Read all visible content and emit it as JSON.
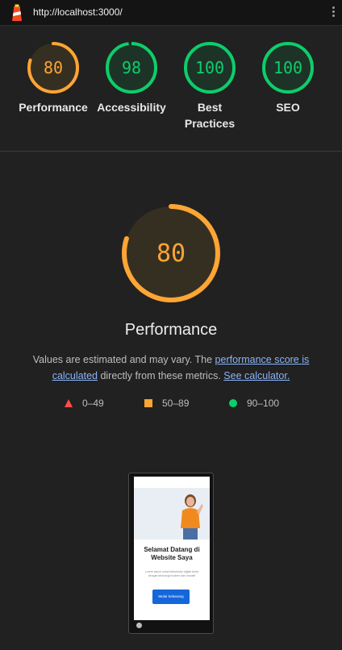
{
  "browser": {
    "url": "http://localhost:3000/"
  },
  "categories": [
    {
      "score": 80,
      "label": "Performance",
      "color": "#ffa534"
    },
    {
      "score": 98,
      "label": "Accessibility",
      "color": "#0cce6b"
    },
    {
      "score": 100,
      "label": "Best Practices",
      "color": "#0cce6b"
    },
    {
      "score": 100,
      "label": "SEO",
      "color": "#0cce6b"
    }
  ],
  "performance": {
    "score": 80,
    "title": "Performance",
    "desc_before": "Values are estimated and may vary. The ",
    "desc_link": "performance score is calculated",
    "desc_middle": " directly from these metrics.",
    "calc_link": "See calculator.",
    "color": "#ffa534"
  },
  "legend": [
    {
      "range": "0–49",
      "shape": "triangle",
      "color": "#ff4e42"
    },
    {
      "range": "50–89",
      "shape": "square",
      "color": "#ffa534"
    },
    {
      "range": "90–100",
      "shape": "circle",
      "color": "#0cce6b"
    }
  ],
  "screenshot": {
    "heading": "Selamat Datang di Website Saya",
    "subtext": "Lorem ipsum untuk kebutuhan digital Anda dengan teknologi modern dan inovatif",
    "button": "Mulai Sekarang"
  }
}
